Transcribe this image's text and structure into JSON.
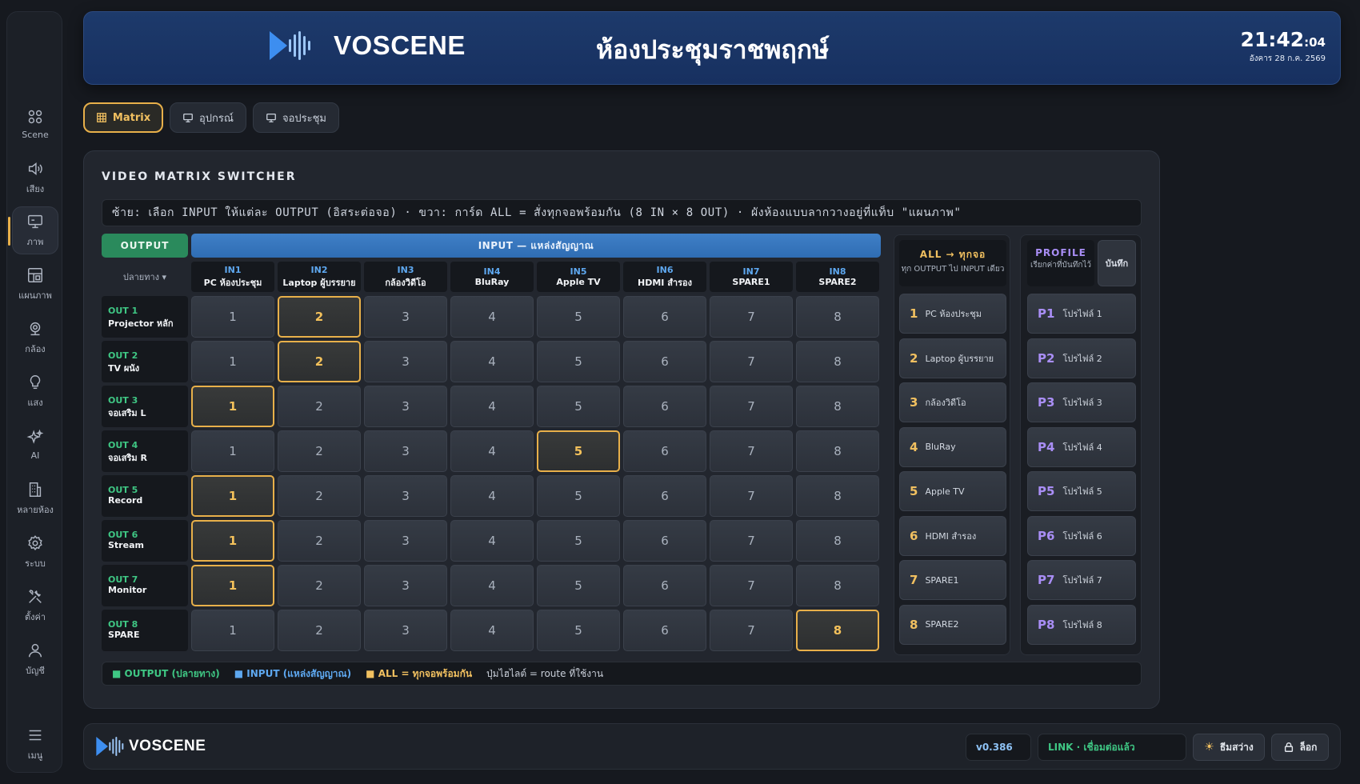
{
  "brand": {
    "name": "VOSCENE"
  },
  "header": {
    "room_title": "ห้องประชุมราชพฤกษ์",
    "time": "21:42",
    "seconds": ":04",
    "date": "อังคาร 28 ก.ค. 2569"
  },
  "sidebar": {
    "items": [
      {
        "label": "Scene",
        "icon": "grid-icon"
      },
      {
        "label": "เสียง",
        "icon": "speaker-icon"
      },
      {
        "label": "ภาพ",
        "icon": "monitor-icon"
      },
      {
        "label": "แผนภาพ",
        "icon": "layout-icon"
      },
      {
        "label": "กล้อง",
        "icon": "camera-icon"
      },
      {
        "label": "แสง",
        "icon": "bulb-icon"
      },
      {
        "label": "AI",
        "icon": "sparkle-icon"
      },
      {
        "label": "หลายห้อง",
        "icon": "building-icon"
      },
      {
        "label": "ระบบ",
        "icon": "gear-icon"
      },
      {
        "label": "ตั้งค่า",
        "icon": "tools-icon"
      },
      {
        "label": "บัญชี",
        "icon": "user-icon"
      }
    ],
    "menu_label": "เมนู",
    "active_index": 2
  },
  "tabs": [
    {
      "label": "Matrix"
    },
    {
      "label": "อุปกรณ์"
    },
    {
      "label": "จอประชุม"
    }
  ],
  "panel": {
    "title": "VIDEO MATRIX SWITCHER",
    "info": "ซ้าย: เลือก INPUT ให้แต่ละ OUTPUT (อิสระต่อจอ) · ขวา: การ์ด ALL = สั่งทุกจอพร้อมกัน (8 IN × 8 OUT) · ผังห้องแบบลากวางอยู่ที่แท็บ \"แผนภาพ\"",
    "output_header": "OUTPUT",
    "input_header": "INPUT — แหล่งสัญญาณ",
    "destination_label": "ปลายทาง ▾"
  },
  "inputs": [
    {
      "id": "IN1",
      "name": "PC ห้องประชุม"
    },
    {
      "id": "IN2",
      "name": "Laptop ผู้บรรยาย"
    },
    {
      "id": "IN3",
      "name": "กล้องวิดีโอ"
    },
    {
      "id": "IN4",
      "name": "BluRay"
    },
    {
      "id": "IN5",
      "name": "Apple TV"
    },
    {
      "id": "IN6",
      "name": "HDMI สำรอง"
    },
    {
      "id": "IN7",
      "name": "SPARE1"
    },
    {
      "id": "IN8",
      "name": "SPARE2"
    }
  ],
  "outputs": [
    {
      "id": "OUT 1",
      "name": "Projector หลัก",
      "route": 2
    },
    {
      "id": "OUT 2",
      "name": "TV ผนัง",
      "route": 2
    },
    {
      "id": "OUT 3",
      "name": "จอเสริม L",
      "route": 1
    },
    {
      "id": "OUT 4",
      "name": "จอเสริม R",
      "route": 5
    },
    {
      "id": "OUT 5",
      "name": "Record",
      "route": 1
    },
    {
      "id": "OUT 6",
      "name": "Stream",
      "route": 1
    },
    {
      "id": "OUT 7",
      "name": "Monitor",
      "route": 1
    },
    {
      "id": "OUT 8",
      "name": "SPARE",
      "route": 8
    }
  ],
  "cell_labels": [
    "1",
    "2",
    "3",
    "4",
    "5",
    "6",
    "7",
    "8"
  ],
  "all_card": {
    "title": "ALL → ทุกจอ",
    "desc": "ทุก OUTPUT ไป INPUT เดียว",
    "buttons": [
      {
        "key": "1",
        "label": "PC ห้องประชุม"
      },
      {
        "key": "2",
        "label": "Laptop ผู้บรรยาย"
      },
      {
        "key": "3",
        "label": "กล้องวิดีโอ"
      },
      {
        "key": "4",
        "label": "BluRay"
      },
      {
        "key": "5",
        "label": "Apple TV"
      },
      {
        "key": "6",
        "label": "HDMI สำรอง"
      },
      {
        "key": "7",
        "label": "SPARE1"
      },
      {
        "key": "8",
        "label": "SPARE2"
      }
    ]
  },
  "profile": {
    "title": "PROFILE",
    "desc": "เรียกค่าที่บันทึกไว้",
    "save_label": "บันทึก",
    "items": [
      {
        "key": "P1",
        "label": "โปรไฟล์ 1"
      },
      {
        "key": "P2",
        "label": "โปรไฟล์ 2"
      },
      {
        "key": "P3",
        "label": "โปรไฟล์ 3"
      },
      {
        "key": "P4",
        "label": "โปรไฟล์ 4"
      },
      {
        "key": "P5",
        "label": "โปรไฟล์ 5"
      },
      {
        "key": "P6",
        "label": "โปรไฟล์ 6"
      },
      {
        "key": "P7",
        "label": "โปรไฟล์ 7"
      },
      {
        "key": "P8",
        "label": "โปรไฟล์ 8"
      }
    ]
  },
  "legend": {
    "output": "■ OUTPUT (ปลายทาง)",
    "input": "■ INPUT (แหล่งสัญญาณ)",
    "all": "■ ALL = ทุกจอพร้อมกัน",
    "note": "ปุ่มไฮไลต์ = route ที่ใช้งาน"
  },
  "footer": {
    "version": "v0.386",
    "link_status": "LINK · เชื่อมต่อแล้ว",
    "theme_label": "ธีมสว่าง",
    "lock_label": "ล็อก"
  },
  "colors": {
    "accent": "#e8b04a",
    "output_green": "#3fc784",
    "input_blue": "#5ea8f0",
    "profile_purple": "#a98ef5",
    "header_blue": "#1d3a6b"
  }
}
